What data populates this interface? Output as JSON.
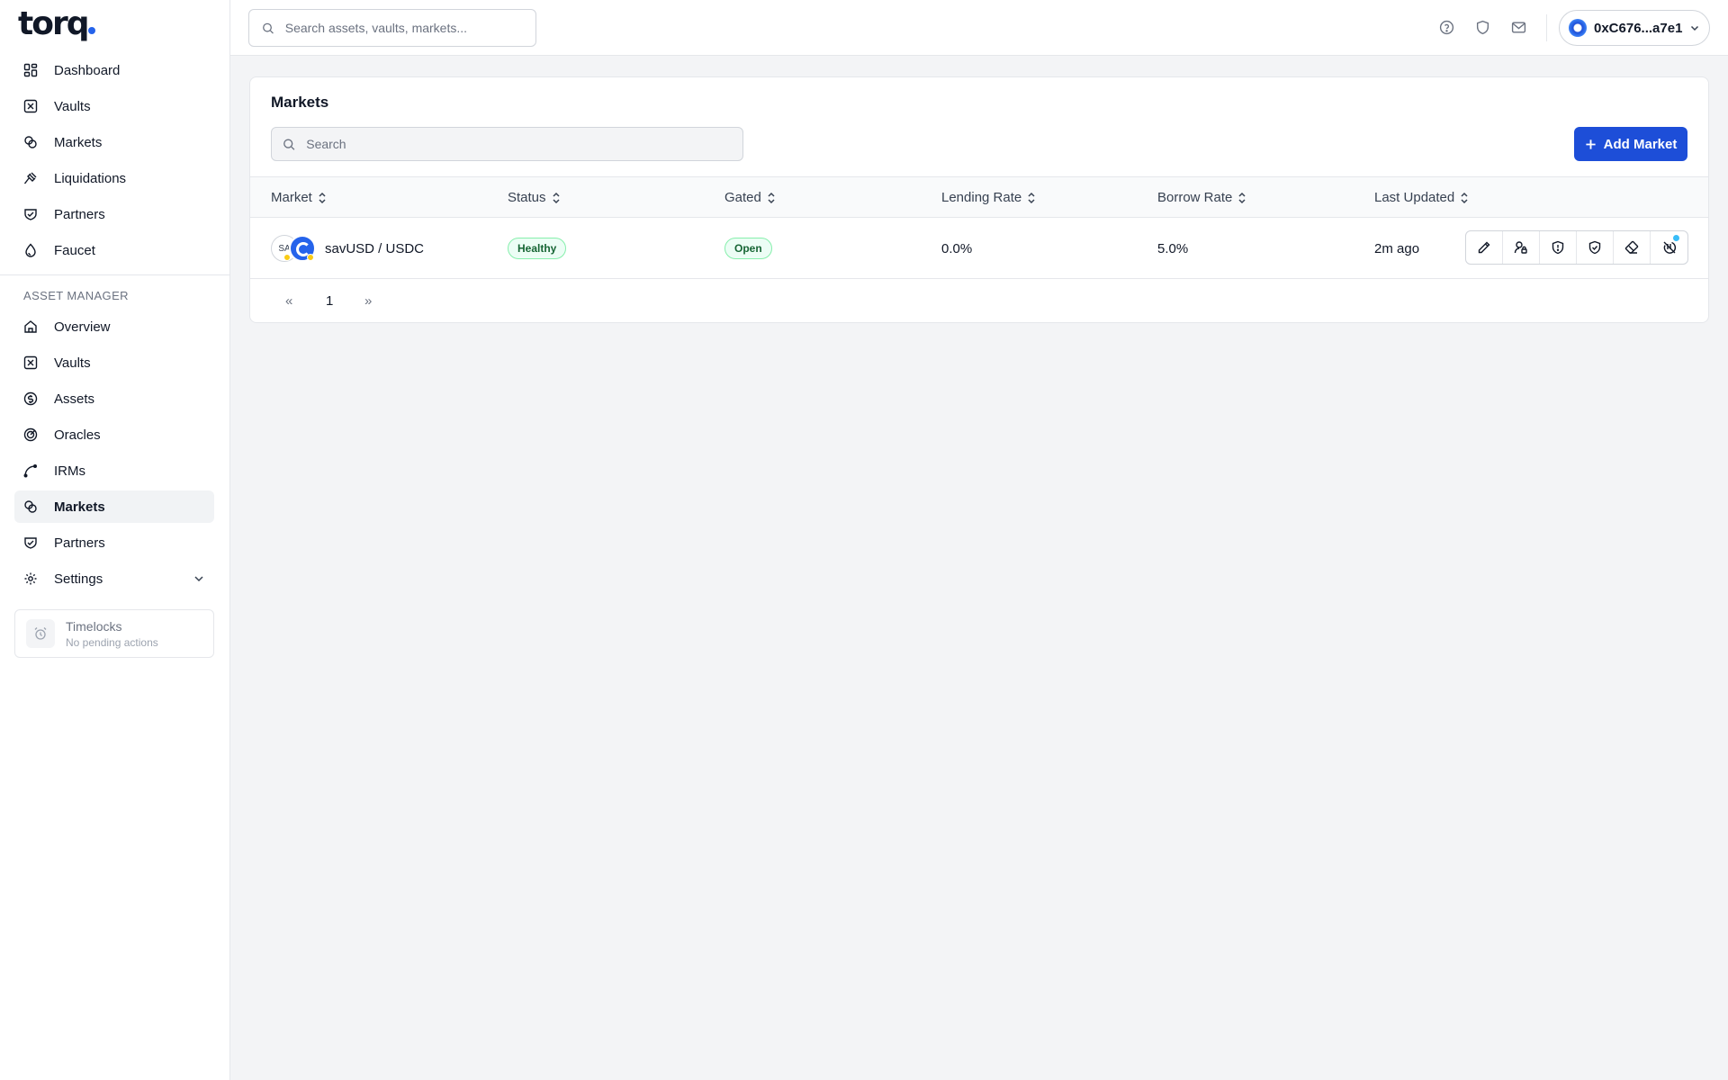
{
  "brand": {
    "logo_text": "torq",
    "accent": "#2563eb"
  },
  "sidebar": {
    "primary": [
      {
        "label": "Dashboard",
        "icon": "dashboard-icon"
      },
      {
        "label": "Vaults",
        "icon": "vault-icon"
      },
      {
        "label": "Markets",
        "icon": "link-icon"
      },
      {
        "label": "Liquidations",
        "icon": "gavel-icon"
      },
      {
        "label": "Partners",
        "icon": "handshake-icon"
      },
      {
        "label": "Faucet",
        "icon": "droplet-icon"
      }
    ],
    "section_label": "ASSET MANAGER",
    "manager": [
      {
        "label": "Overview",
        "icon": "home-icon"
      },
      {
        "label": "Vaults",
        "icon": "vault-icon"
      },
      {
        "label": "Assets",
        "icon": "coin-icon"
      },
      {
        "label": "Oracles",
        "icon": "radar-icon"
      },
      {
        "label": "IRMs",
        "icon": "curve-icon"
      },
      {
        "label": "Markets",
        "icon": "link-icon",
        "active": true
      },
      {
        "label": "Partners",
        "icon": "handshake-icon"
      },
      {
        "label": "Settings",
        "icon": "gear-icon",
        "expandable": true
      }
    ],
    "timelocks": {
      "title": "Timelocks",
      "subtitle": "No pending actions"
    }
  },
  "header": {
    "search_placeholder": "Search assets, vaults, markets...",
    "icons": [
      "help-icon",
      "shield-icon",
      "mail-icon"
    ],
    "wallet_address": "0xC676...a7e1"
  },
  "main": {
    "title": "Markets",
    "search_placeholder": "Search",
    "add_button_label": "Add Market",
    "columns": [
      "Market",
      "Status",
      "Gated",
      "Lending Rate",
      "Borrow Rate",
      "Last Updated"
    ],
    "rows": [
      {
        "token_a_label": "SA",
        "market": "savUSD / USDC",
        "status": "Healthy",
        "gated": "Open",
        "lending_rate": "0.0%",
        "borrow_rate": "5.0%",
        "last_updated": "2m ago",
        "actions": [
          "pencil-icon",
          "user-lock-icon",
          "shield-alert-icon",
          "shield-check-icon",
          "eraser-icon",
          "pause-icon"
        ]
      }
    ],
    "pagination": {
      "prev": "«",
      "current": "1",
      "next": "»"
    }
  }
}
